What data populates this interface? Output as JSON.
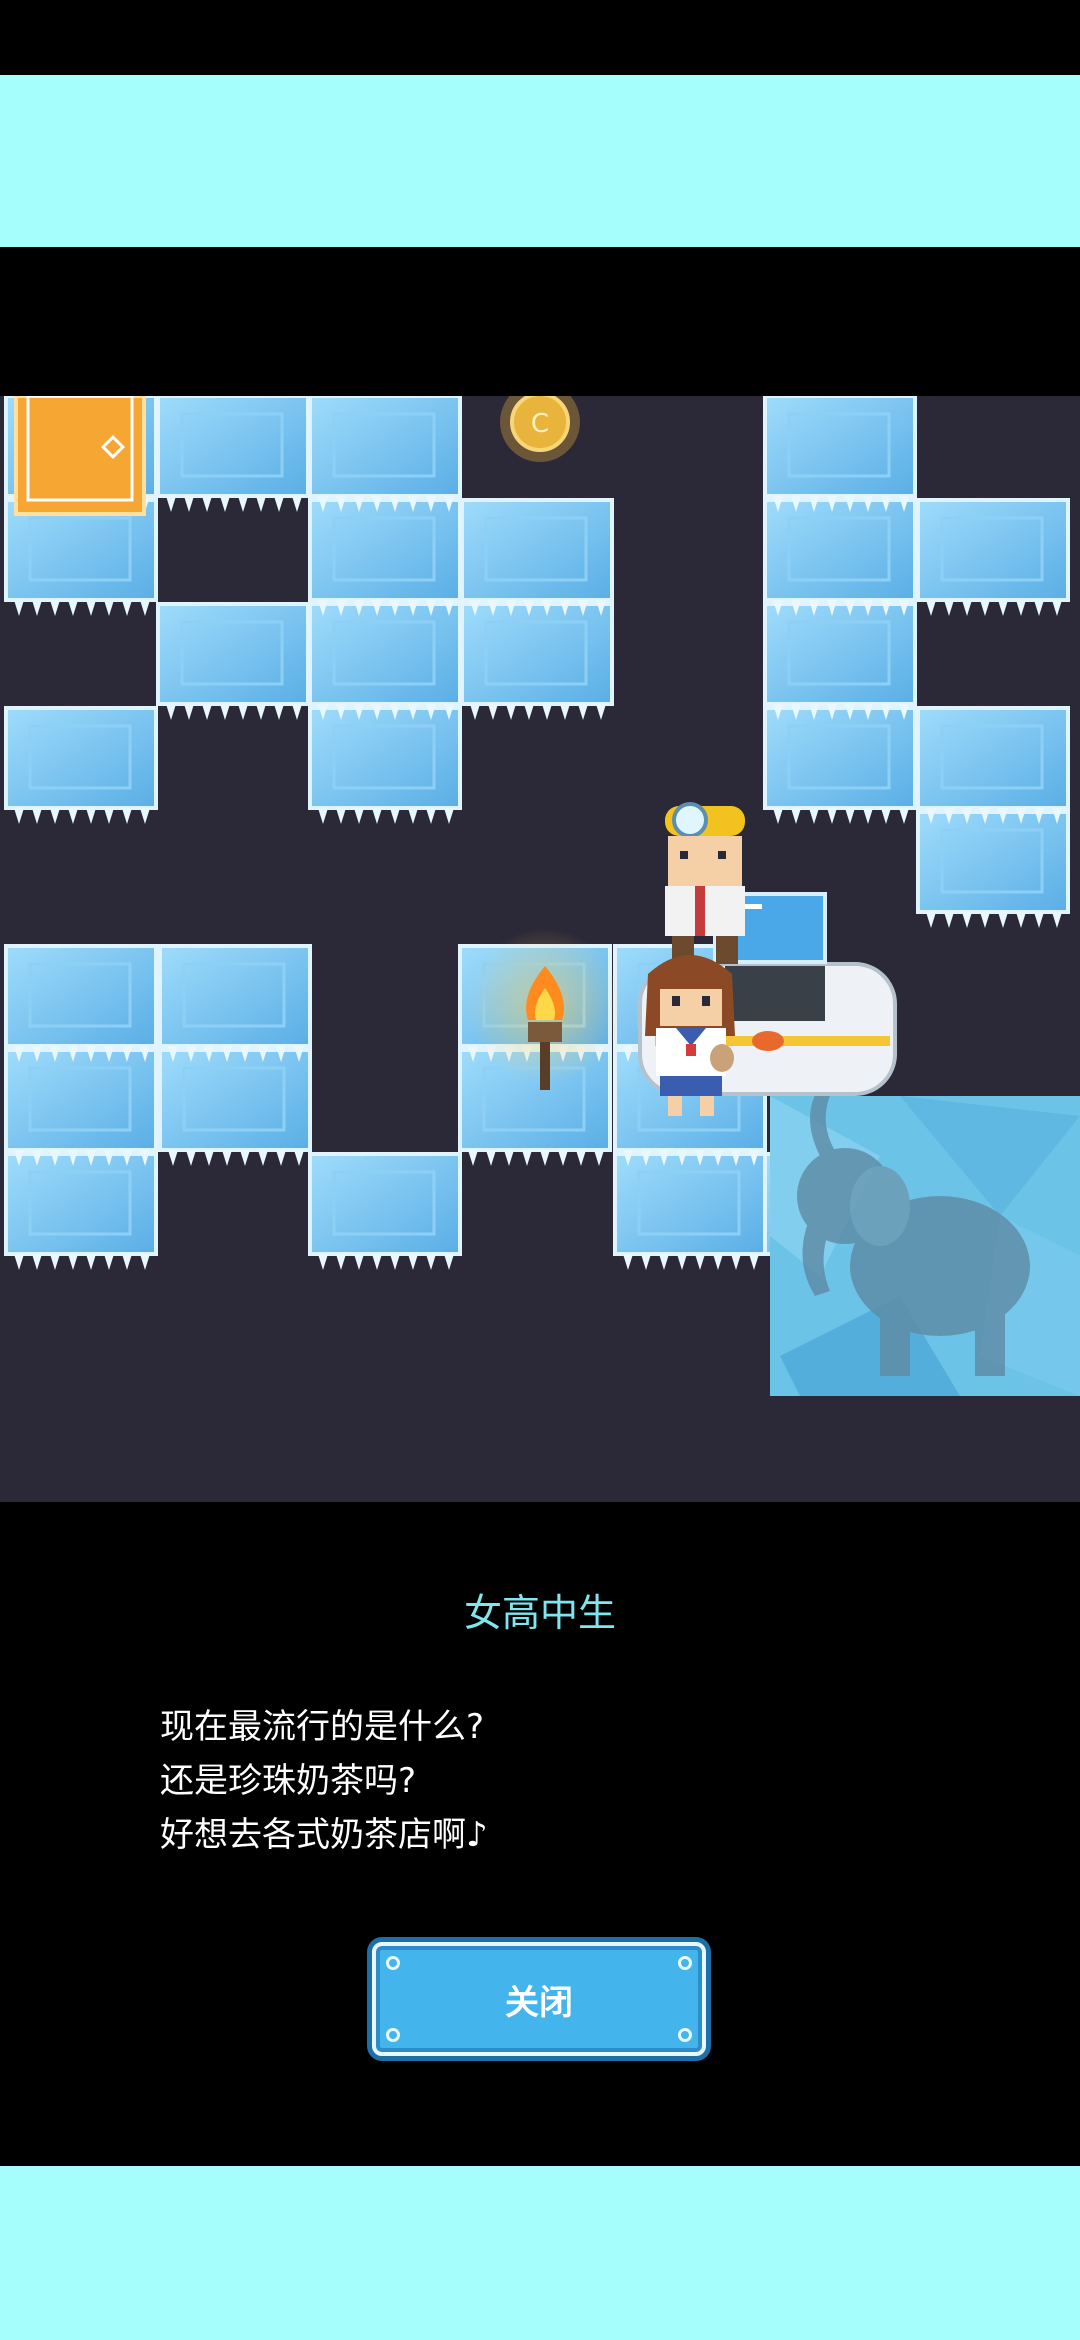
{
  "dialog": {
    "speaker_name": "女高中生",
    "lines": [
      "现在最流行的是什么?",
      "还是珍珠奶茶吗?",
      "好想去各式奶茶店啊♪"
    ],
    "close_label": "关闭"
  },
  "colors": {
    "band": "#a5fefb",
    "ice": "#6ab9ec",
    "cave": "#2b2838",
    "speaker_text": "#7fe6ee",
    "button": "#43b4ec",
    "door": "#f6a632"
  },
  "icons": {
    "coin": "coin-icon",
    "door": "door-icon",
    "torch": "torch-icon",
    "frozen_elephant": "elephant-icon"
  }
}
